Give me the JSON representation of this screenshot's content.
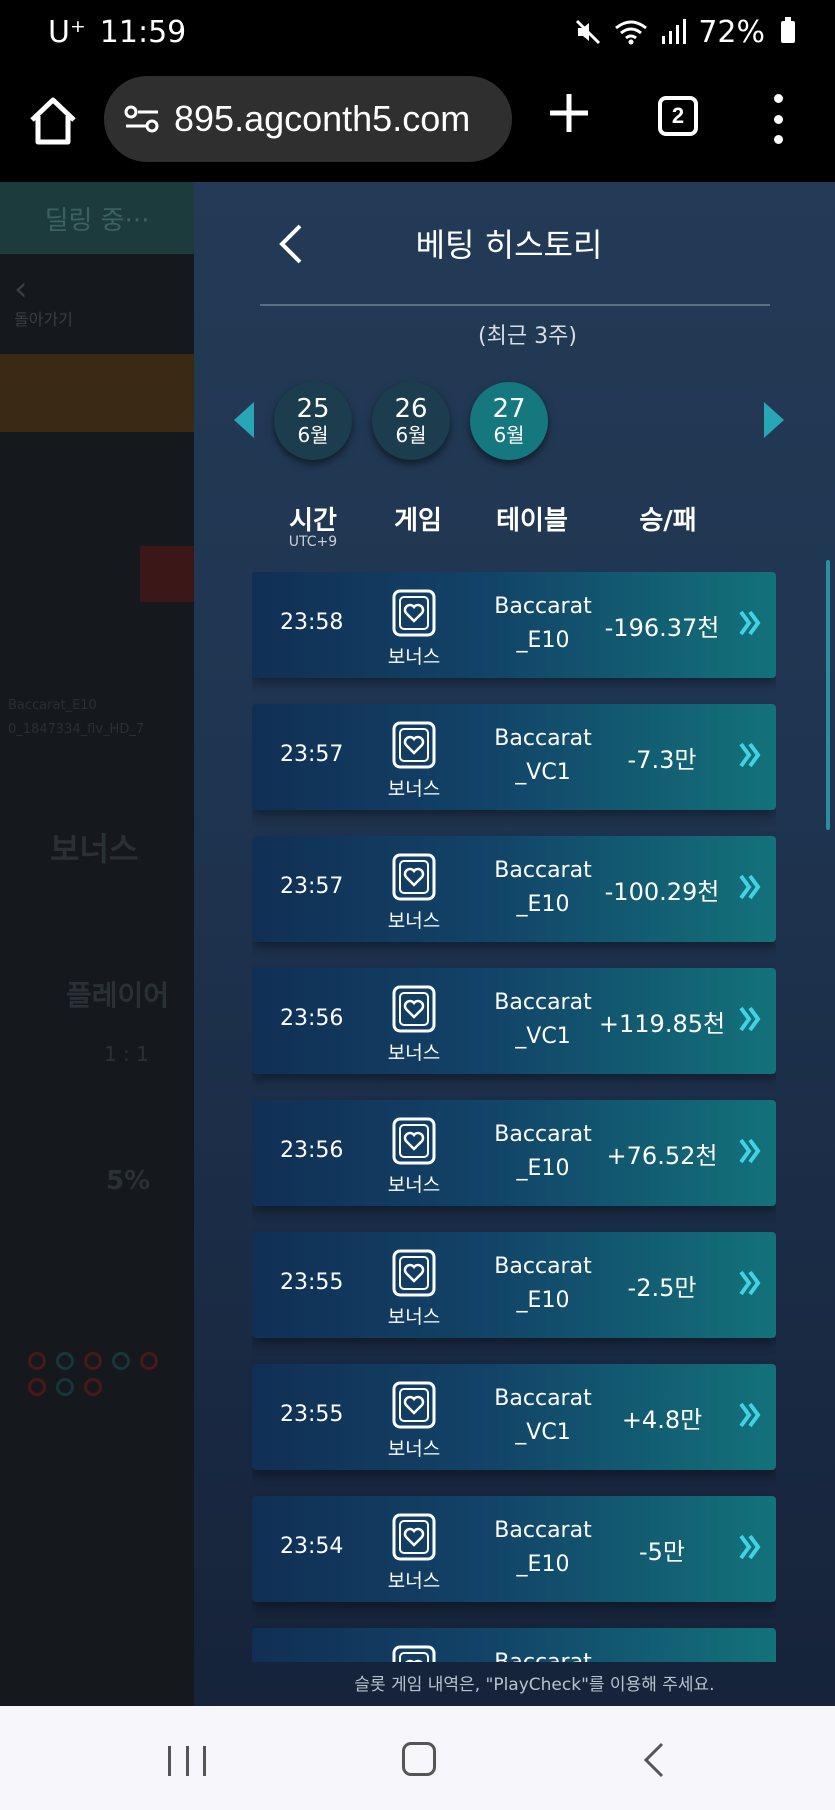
{
  "status_bar": {
    "carrier": "U⁺",
    "time": "11:59",
    "battery": "72%",
    "icons": [
      "mute-icon",
      "wifi-icon",
      "signal-icon",
      "battery-icon"
    ]
  },
  "browser": {
    "url": "895.agconth5.com",
    "tab_count": "2"
  },
  "background_page": {
    "dealing_label": "딜링 중···",
    "back_label": "돌아가기",
    "table_id": "Baccarat_E10",
    "round_id": "0_1847334_flv_HD_7",
    "bonus_label": "보너스",
    "player_label": "플레이어",
    "odds": "1 : 1",
    "percent": "5%"
  },
  "panel": {
    "title": "베팅 히스토리",
    "subtitle": "(최근 3주)",
    "dates": [
      {
        "day": "25",
        "month": "6월",
        "active": false
      },
      {
        "day": "26",
        "month": "6월",
        "active": false
      },
      {
        "day": "27",
        "month": "6월",
        "active": true
      }
    ],
    "columns": {
      "time": "시간",
      "time_sub": "UTC+9",
      "game": "게임",
      "table": "테이블",
      "result": "승/패"
    },
    "rows": [
      {
        "time": "23:58",
        "game": "보너스",
        "table_1": "Baccarat",
        "table_2": "_E10",
        "result": "-196.37천"
      },
      {
        "time": "23:57",
        "game": "보너스",
        "table_1": "Baccarat",
        "table_2": "_VC1",
        "result": "-7.3만"
      },
      {
        "time": "23:57",
        "game": "보너스",
        "table_1": "Baccarat",
        "table_2": "_E10",
        "result": "-100.29천"
      },
      {
        "time": "23:56",
        "game": "보너스",
        "table_1": "Baccarat",
        "table_2": "_VC1",
        "result": "+119.85천"
      },
      {
        "time": "23:56",
        "game": "보너스",
        "table_1": "Baccarat",
        "table_2": "_E10",
        "result": "+76.52천"
      },
      {
        "time": "23:55",
        "game": "보너스",
        "table_1": "Baccarat",
        "table_2": "_E10",
        "result": "-2.5만"
      },
      {
        "time": "23:55",
        "game": "보너스",
        "table_1": "Baccarat",
        "table_2": "_VC1",
        "result": "+4.8만"
      },
      {
        "time": "23:54",
        "game": "보너스",
        "table_1": "Baccarat",
        "table_2": "_E10",
        "result": "-5만"
      },
      {
        "time": "",
        "game": "",
        "table_1": "Baccarat",
        "table_2": "",
        "result": ""
      }
    ],
    "footer_note": "슬롯 게임 내역은, \"PlayCheck\"를 이용해 주세요."
  },
  "colors": {
    "accent": "#29a6b6",
    "active_date": "#14787e"
  }
}
